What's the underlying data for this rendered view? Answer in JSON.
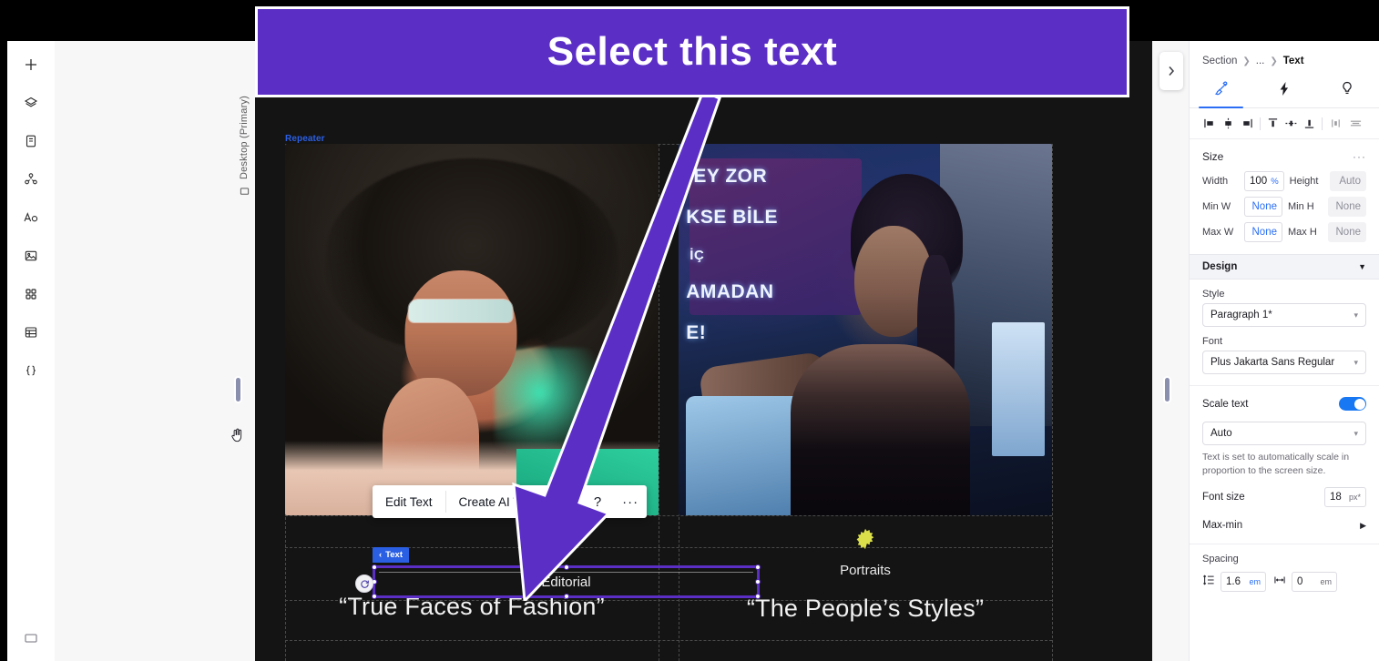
{
  "callout": {
    "text": "Select this text",
    "color": "#5B2EC6"
  },
  "left_rail": {
    "items": [
      {
        "name": "add-icon",
        "label": "Add"
      },
      {
        "name": "layers-icon",
        "label": "Layers"
      },
      {
        "name": "pages-icon",
        "label": "Pages"
      },
      {
        "name": "apps-connections-icon",
        "label": "Connections"
      },
      {
        "name": "theme-typography-icon",
        "label": "Site Theme"
      },
      {
        "name": "media-image-icon",
        "label": "Media"
      },
      {
        "name": "apps-grid-icon",
        "label": "Apps"
      },
      {
        "name": "cms-table-icon",
        "label": "CMS"
      },
      {
        "name": "dev-mode-icon",
        "label": "{ }"
      }
    ]
  },
  "viewport": {
    "label": "Desktop (Primary)"
  },
  "canvas": {
    "repeater_tag": "Repeater",
    "selection_badge": "Text",
    "cards": [
      {
        "category": "Editorial",
        "quote": "“True Faces of Fashion”",
        "selected": true
      },
      {
        "category": "Portraits",
        "quote": "“The People’s Styles”",
        "selected": false
      }
    ],
    "photo2_graffiti": [
      "EY ZOR",
      "KSE BİLE",
      "İÇ",
      "AMADAN",
      "E!"
    ],
    "starburst_color": "#DBE04A"
  },
  "float_toolbar": {
    "items": [
      {
        "name": "edit-text-button",
        "label": "Edit Text"
      },
      {
        "name": "create-ai-text-button",
        "label": "Create AI Text"
      },
      {
        "name": "link-icon",
        "label": ""
      },
      {
        "name": "help-icon",
        "label": "?"
      },
      {
        "name": "more-options-icon",
        "label": "···"
      }
    ]
  },
  "right_panel": {
    "breadcrumb": {
      "root": "Section",
      "middle": "...",
      "current": "Text"
    },
    "tabs": [
      {
        "name": "design-tab",
        "icon": "paintbrush-icon",
        "active": true
      },
      {
        "name": "interactions-tab",
        "icon": "lightning-icon",
        "active": false
      },
      {
        "name": "ideas-tab",
        "icon": "lightbulb-icon",
        "active": false
      }
    ],
    "align_buttons": [
      "align-left-icon",
      "align-center-horizontal-icon",
      "align-right-icon",
      "align-top-icon",
      "align-middle-vertical-icon",
      "align-bottom-icon",
      "distribute-horizontal-icon",
      "stack-icon"
    ],
    "size": {
      "title": "Size",
      "more": "···",
      "fields": [
        {
          "label": "Width",
          "value": "100",
          "unit": "%",
          "ghost": false
        },
        {
          "label": "Height",
          "value": "Auto",
          "unit": "",
          "ghost": true
        },
        {
          "label": "Min W",
          "value": "None",
          "unit": "",
          "ghost": false
        },
        {
          "label": "Min H",
          "value": "None",
          "unit": "",
          "ghost": true
        },
        {
          "label": "Max W",
          "value": "None",
          "unit": "",
          "ghost": false
        },
        {
          "label": "Max H",
          "value": "None",
          "unit": "",
          "ghost": true
        }
      ]
    },
    "design": {
      "section_title": "Design",
      "style_label": "Style",
      "style_value": "Paragraph 1*",
      "font_label": "Font",
      "font_value": "Plus Jakarta Sans Regular",
      "scale_text_label": "Scale text",
      "scale_text_on": true,
      "scale_mode_value": "Auto",
      "scale_help": "Text is set to automatically scale in proportion to the screen size.",
      "font_size_label": "Font size",
      "font_size_value": "18",
      "font_size_unit": "px*",
      "max_min_label": "Max-min",
      "spacing_label": "Spacing",
      "line_height_value": "1.6",
      "line_height_unit": "em",
      "letter_spacing_value": "0",
      "letter_spacing_unit": "em"
    }
  },
  "colors": {
    "accent_purple": "#5B2EC6",
    "accent_blue": "#2B6EF5",
    "tag_blue": "#2B5FE3"
  }
}
